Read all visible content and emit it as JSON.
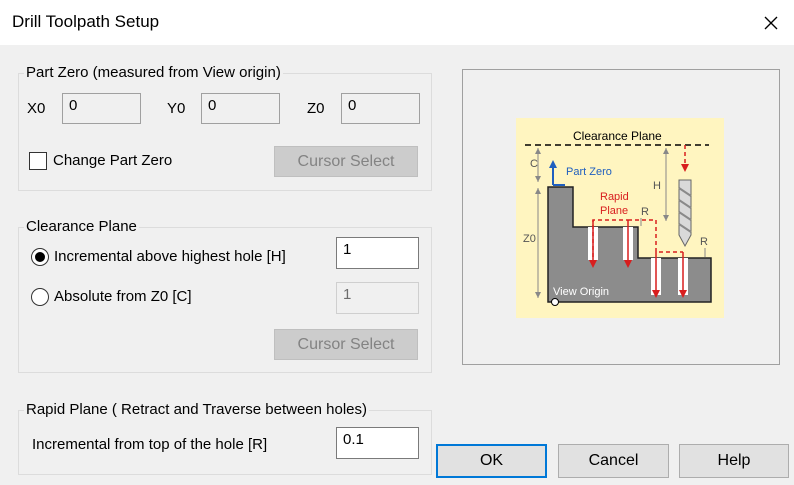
{
  "window": {
    "title": "Drill Toolpath Setup"
  },
  "part_zero": {
    "group_label": "Part Zero (measured from View origin)",
    "x0_label": "X0",
    "x0_value": "0",
    "y0_label": "Y0",
    "y0_value": "0",
    "z0_label": "Z0",
    "z0_value": "0",
    "change_part_zero_label": "Change Part Zero",
    "change_part_zero_checked": false,
    "cursor_select_label": "Cursor Select"
  },
  "clearance_plane": {
    "group_label": "Clearance Plane",
    "incremental_label": "Incremental above highest hole [H]",
    "incremental_value": "1",
    "absolute_label": "Absolute from Z0 [C]",
    "absolute_value": "1",
    "selected": "incremental",
    "cursor_select_label": "Cursor Select"
  },
  "rapid_plane": {
    "group_label": "Rapid Plane ( Retract and Traverse between holes)",
    "incremental_label": "Incremental from top of the hole [R]",
    "incremental_value": "0.1"
  },
  "diagram": {
    "clearance_plane": "Clearance Plane",
    "c": "C",
    "part_zero": "Part Zero",
    "h": "H",
    "rapid": "Rapid",
    "plane": "Plane",
    "r1": "R",
    "r2": "R",
    "z0": "Z0",
    "view_origin": "View Origin"
  },
  "buttons": {
    "ok": "OK",
    "cancel": "Cancel",
    "help": "Help"
  },
  "icons": {
    "close": "close-icon"
  },
  "colors": {
    "diagram_bg": "#fff5c0",
    "part": "#8c8c8c",
    "arrow_blue": "#1f5fbf",
    "rapid_red": "#d81e1e"
  }
}
